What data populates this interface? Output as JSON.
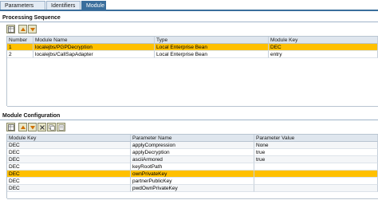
{
  "tabs": [
    {
      "label": "Parameters",
      "active": false
    },
    {
      "label": "Identifiers",
      "active": false
    },
    {
      "label": "Module",
      "active": true
    }
  ],
  "processing_sequence": {
    "title": "Processing Sequence",
    "toolbar_icons": [
      "table-settings-icon",
      "move-up-icon",
      "move-down-icon"
    ],
    "columns": [
      "Number",
      "Module Name",
      "Type",
      "Module Key"
    ],
    "rows": [
      {
        "number": "1",
        "module_name": "localejbs/PGPDecryption",
        "type": "Local Enterprise Bean",
        "module_key": "DEC",
        "selected": true
      },
      {
        "number": "2",
        "module_name": "localejbs/CallSapAdapter",
        "type": "Local Enterprise Bean",
        "module_key": "entry",
        "selected": false
      }
    ]
  },
  "module_configuration": {
    "title": "Module Configuration",
    "toolbar_icons": [
      "table-settings-icon",
      "move-up-icon",
      "move-down-icon",
      "delete-row-icon",
      "copy-row-icon",
      "insert-row-icon"
    ],
    "columns": [
      "Module Key",
      "Parameter Name",
      "Parameter Value"
    ],
    "rows": [
      {
        "module_key": "DEC",
        "parameter_name": "applyCompression",
        "parameter_value": "None",
        "selected": false
      },
      {
        "module_key": "DEC",
        "parameter_name": "applyDecryption",
        "parameter_value": "true",
        "selected": false
      },
      {
        "module_key": "DEC",
        "parameter_name": "asciiArmored",
        "parameter_value": "true",
        "selected": false
      },
      {
        "module_key": "DEC",
        "parameter_name": "keyRootPath",
        "parameter_value": "",
        "selected": false
      },
      {
        "module_key": "DEC",
        "parameter_name": "ownPrivateKey",
        "parameter_value": "",
        "selected": true
      },
      {
        "module_key": "DEC",
        "parameter_name": "partnerPublicKey",
        "parameter_value": "",
        "selected": false
      },
      {
        "module_key": "DEC",
        "parameter_name": "pwdOwnPrivateKey",
        "parameter_value": "",
        "selected": false
      }
    ]
  },
  "colors": {
    "selected_row": "#ffc000",
    "tab_active": "#3a6e9c",
    "header_bg": "#dfe6ee"
  }
}
